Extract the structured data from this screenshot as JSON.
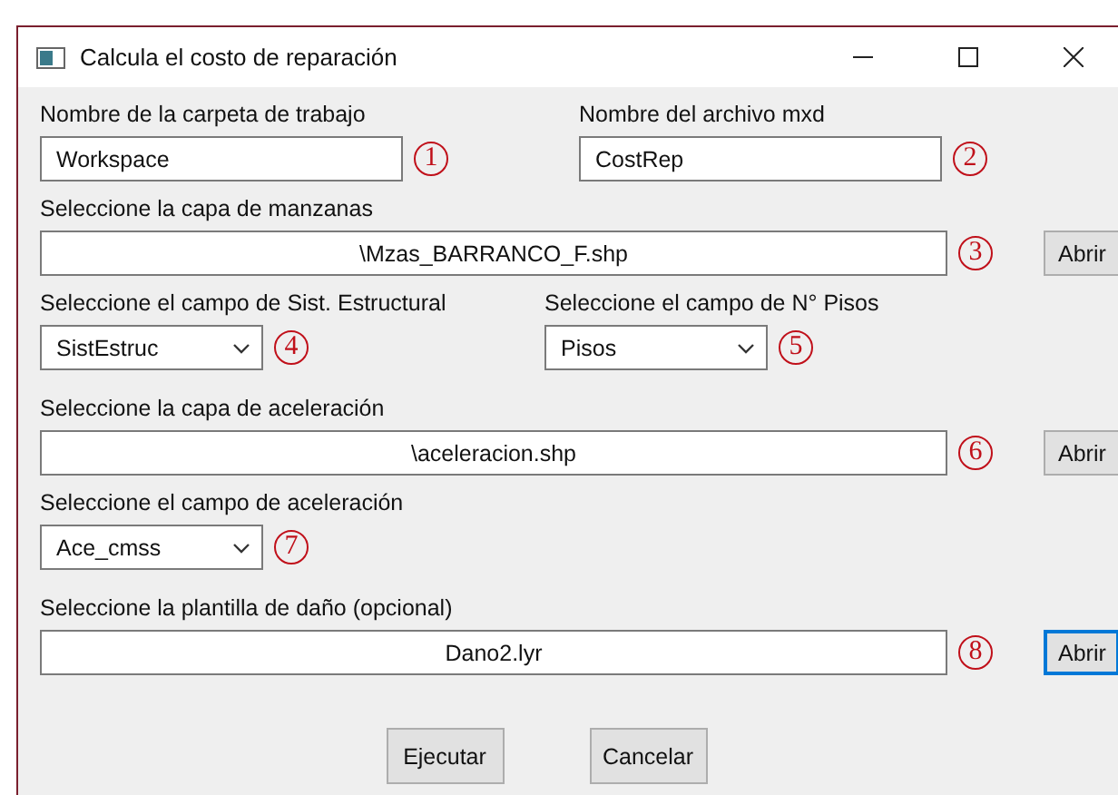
{
  "window": {
    "title": "Calcula el costo de reparación"
  },
  "rows": [
    {
      "fields": [
        {
          "kind": "text",
          "label": "Nombre de la carpeta de trabajo",
          "value": "Workspace",
          "marker": "1"
        },
        {
          "kind": "text",
          "label": "Nombre del archivo mxd",
          "value": "CostRep",
          "marker": "2"
        }
      ]
    },
    {
      "fields": [
        {
          "kind": "file",
          "label": "Seleccione la capa de manzanas",
          "value": "\\Mzas_BARRANCO_F.shp",
          "marker": "3",
          "button": {
            "label": "Abrir",
            "focused": false
          }
        }
      ]
    },
    {
      "fields": [
        {
          "kind": "select",
          "label": "Seleccione el campo de Sist. Estructural",
          "value": "SistEstruc",
          "marker": "4"
        },
        {
          "kind": "select",
          "label": "Seleccione el campo de N° Pisos",
          "value": "Pisos",
          "marker": "5"
        }
      ]
    },
    {
      "fields": [
        {
          "kind": "file",
          "label": "Seleccione la capa de aceleración",
          "value": "\\aceleracion.shp",
          "marker": "6",
          "button": {
            "label": "Abrir",
            "focused": false
          }
        }
      ]
    },
    {
      "fields": [
        {
          "kind": "select",
          "label": "Seleccione el campo de aceleración",
          "value": "Ace_cmss",
          "marker": "7"
        }
      ]
    },
    {
      "fields": [
        {
          "kind": "file",
          "label": "Seleccione la plantilla de daño (opcional)",
          "value": "Dano2.lyr",
          "marker": "8",
          "button": {
            "label": "Abrir",
            "focused": true
          }
        }
      ]
    }
  ],
  "buttons": [
    "Ejecutar",
    "Cancelar"
  ]
}
